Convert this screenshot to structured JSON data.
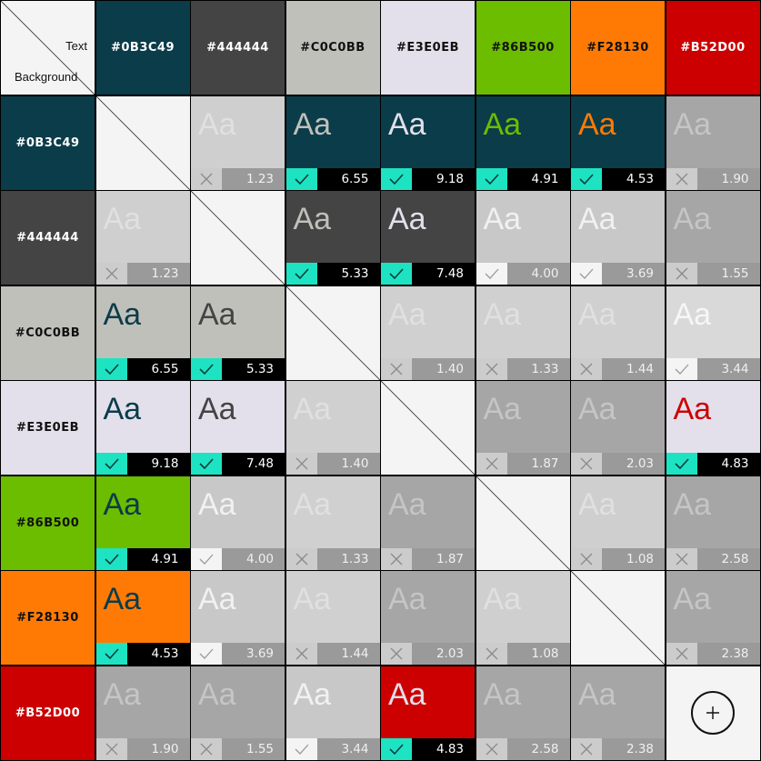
{
  "corner": {
    "text_label": "Text",
    "background_label": "Background"
  },
  "colors": [
    {
      "label": "#0B3C49",
      "hex": "#0B3C49",
      "label_color": "#ffffff"
    },
    {
      "label": "#444444",
      "hex": "#444444",
      "label_color": "#ffffff"
    },
    {
      "label": "#C0C0BB",
      "hex": "#C0C0BB",
      "label_color": "#111111"
    },
    {
      "label": "#E3E0EB",
      "hex": "#E3E0EB",
      "label_color": "#111111"
    },
    {
      "label": "#86B500",
      "hex": "#6CBC00",
      "label_color": "#111111"
    },
    {
      "label": "#F28130",
      "hex": "#FF7A05",
      "label_color": "#111111"
    },
    {
      "label": "#B52D00",
      "hex": "#CC0000",
      "label_color": "#ffffff"
    }
  ],
  "sample_text": "Aa",
  "ratios": [
    [
      null,
      "1.23",
      "6.55",
      "9.18",
      "4.91",
      "4.53",
      "1.90"
    ],
    [
      "1.23",
      null,
      "5.33",
      "7.48",
      "4.00",
      "3.69",
      "1.55"
    ],
    [
      "6.55",
      "5.33",
      null,
      "1.40",
      "1.33",
      "1.44",
      "3.44"
    ],
    [
      "9.18",
      "7.48",
      "1.40",
      null,
      "1.87",
      "2.03",
      "4.83"
    ],
    [
      "4.91",
      "4.00",
      "1.33",
      "1.87",
      null,
      "1.08",
      "2.58"
    ],
    [
      "4.53",
      "3.69",
      "1.44",
      "2.03",
      "1.08",
      null,
      "2.38"
    ],
    [
      "1.90",
      "1.55",
      "3.44",
      "4.83",
      "2.58",
      "2.38",
      null
    ]
  ],
  "status_icons": {
    "pass": "check-icon",
    "large_only": "check-light-icon",
    "fail": "cross-icon"
  },
  "status_colors": {
    "pass_mark": "#1DE3C3",
    "pass_bar": "#000000",
    "large_mark": "#f4f4f4",
    "large_bar": "#9a9a9a",
    "fail_mark": "#cccccc",
    "fail_bar": "#9a9a9a",
    "fail_bg": "#a6a6a6",
    "fail_bg_light": "#d0d0d0"
  },
  "add_button": {
    "icon": "plus-icon"
  }
}
